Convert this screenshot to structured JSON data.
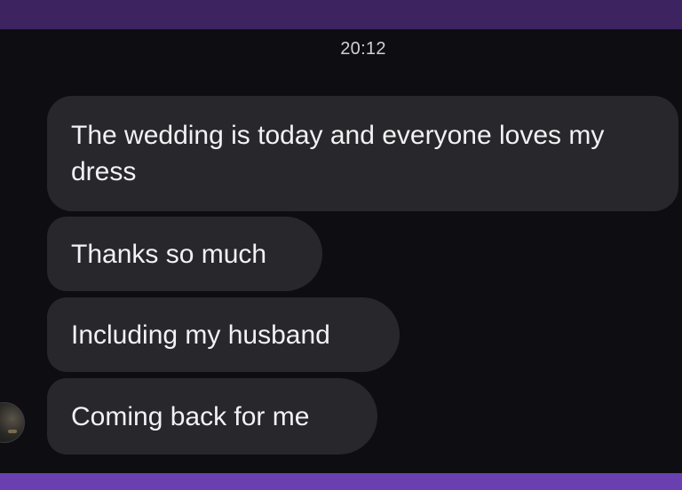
{
  "header": {
    "timestamp": "20:12"
  },
  "messages": [
    {
      "text": "The wedding is today and everyone loves my dress"
    },
    {
      "text": "Thanks so much"
    },
    {
      "text": "Including my husband"
    },
    {
      "text": "Coming back for me"
    }
  ],
  "colors": {
    "top_bar": "#3d2461",
    "bottom_bar": "#6a3fb0",
    "background": "#0d0d12",
    "bubble": "#27272c",
    "text": "#f2f2f4",
    "timestamp": "#cfcfd4"
  },
  "icons": {
    "avatar": "sender-avatar"
  }
}
